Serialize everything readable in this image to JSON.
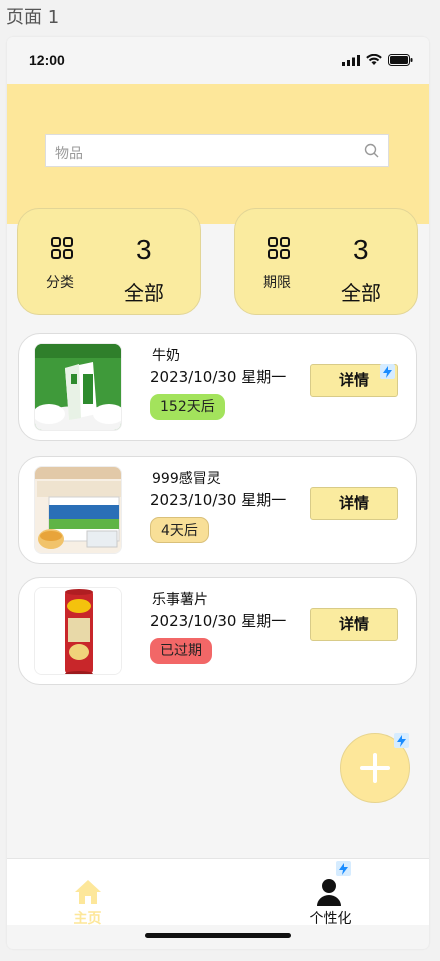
{
  "page_label": "页面 1",
  "status": {
    "time": "12:00"
  },
  "search": {
    "placeholder": "物品"
  },
  "stats": [
    {
      "label": "分类",
      "count": "3",
      "all": "全部"
    },
    {
      "label": "期限",
      "count": "3",
      "all": "全部"
    }
  ],
  "items": [
    {
      "name": "牛奶",
      "date": "2023/10/30 星期一",
      "badge": "152天后",
      "badge_color": "#a3e35c",
      "detail": "详情"
    },
    {
      "name": "999感冒灵",
      "date": "2023/10/30 星期一",
      "badge": "4天后",
      "badge_color": "#f8df97",
      "detail": "详情"
    },
    {
      "name": "乐事薯片",
      "date": "2023/10/30 星期一",
      "badge": "已过期",
      "badge_color": "#f26767",
      "detail": "详情"
    }
  ],
  "tabs": {
    "home": "主页",
    "profile": "个性化"
  },
  "colors": {
    "accent": "#fde79a",
    "card": "#faeb9f",
    "home_tab": "#fde79a"
  }
}
